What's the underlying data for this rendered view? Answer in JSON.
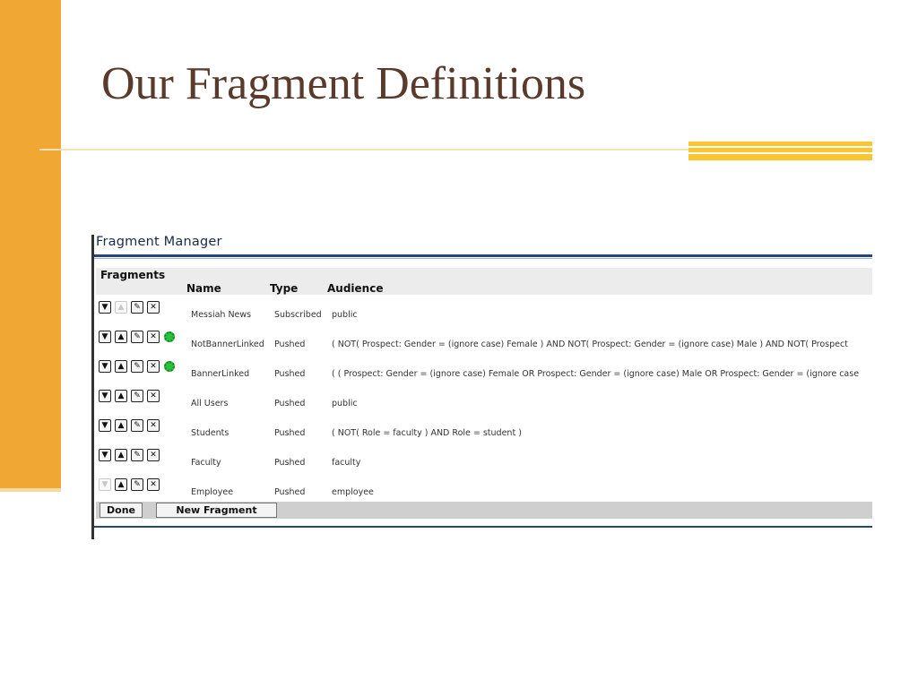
{
  "slide": {
    "title": "Our Fragment Definitions",
    "accent_color": "#f0a733"
  },
  "fragment_manager": {
    "window_title": "Fragment Manager",
    "section_label": "Fragments",
    "columns": {
      "name": "Name",
      "type": "Type",
      "audience": "Audience"
    },
    "rows": [
      {
        "name": "Messiah News",
        "type": "Subscribed",
        "audience": "public",
        "move_down_enabled": true,
        "move_up_enabled": false,
        "has_status_icon": false
      },
      {
        "name": "NotBannerLinked",
        "type": "Pushed",
        "audience": "( NOT( Prospect: Gender = (ignore case) Female ) AND NOT( Prospect: Gender = (ignore case) Male ) AND NOT( Prospect",
        "move_down_enabled": true,
        "move_up_enabled": true,
        "has_status_icon": true
      },
      {
        "name": "BannerLinked",
        "type": "Pushed",
        "audience": "( ( Prospect: Gender = (ignore case) Female OR Prospect: Gender = (ignore case) Male OR Prospect: Gender = (ignore case",
        "move_down_enabled": true,
        "move_up_enabled": true,
        "has_status_icon": true
      },
      {
        "name": "All Users",
        "type": "Pushed",
        "audience": "public",
        "move_down_enabled": true,
        "move_up_enabled": true,
        "has_status_icon": false
      },
      {
        "name": "Students",
        "type": "Pushed",
        "audience": "( NOT( Role = faculty ) AND Role = student )",
        "move_down_enabled": true,
        "move_up_enabled": true,
        "has_status_icon": false
      },
      {
        "name": "Faculty",
        "type": "Pushed",
        "audience": "faculty",
        "move_down_enabled": true,
        "move_up_enabled": true,
        "has_status_icon": false
      },
      {
        "name": "Employee",
        "type": "Pushed",
        "audience": "employee",
        "move_down_enabled": false,
        "move_up_enabled": true,
        "has_status_icon": false
      }
    ],
    "buttons": {
      "done": "Done",
      "new_fragment": "New Fragment"
    },
    "icons": {
      "move_down": "▼",
      "move_up": "▲",
      "edit": "✎",
      "delete": "✕"
    }
  }
}
